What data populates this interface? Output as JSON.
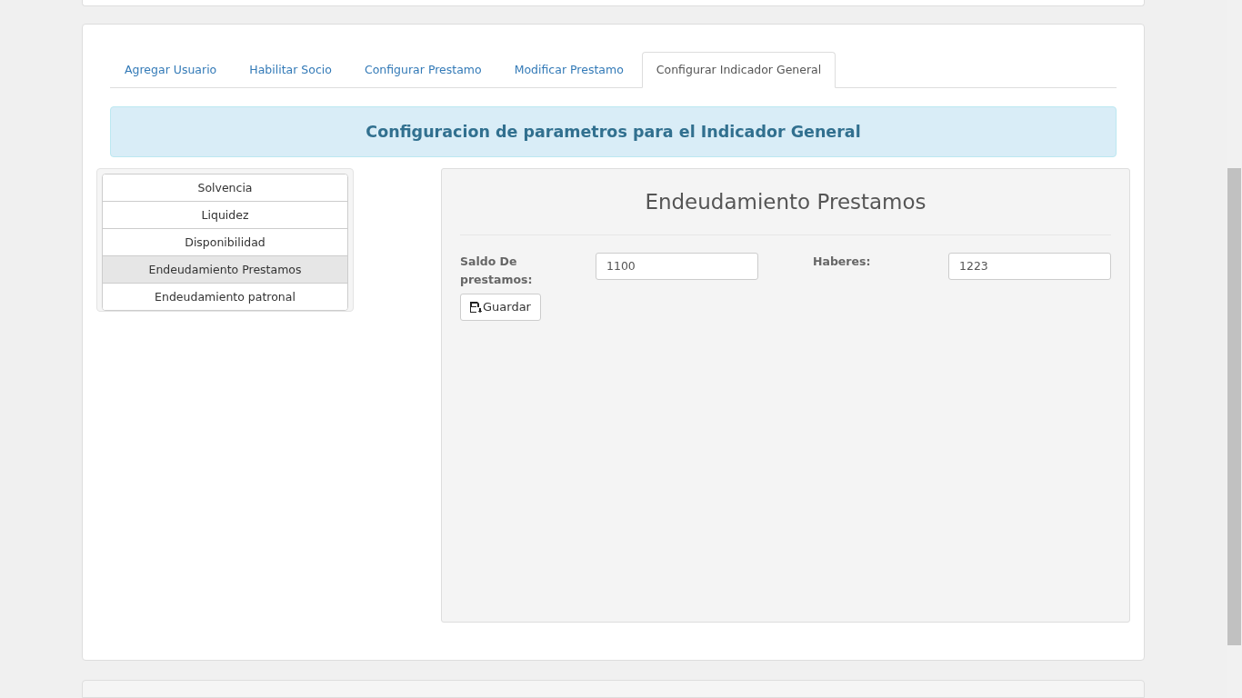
{
  "tabs": [
    {
      "label": "Agregar Usuario",
      "selected": false
    },
    {
      "label": "Habilitar Socio",
      "selected": false
    },
    {
      "label": "Configurar Prestamo",
      "selected": false
    },
    {
      "label": "Modificar Prestamo",
      "selected": false
    },
    {
      "label": "Configurar Indicador General",
      "selected": true
    }
  ],
  "banner": "Configuracion de parametros para el Indicador General",
  "indicators": [
    {
      "label": "Solvencia",
      "selected": false
    },
    {
      "label": "Liquidez",
      "selected": false
    },
    {
      "label": "Disponibilidad",
      "selected": false
    },
    {
      "label": "Endeudamiento Prestamos",
      "selected": true
    },
    {
      "label": "Endeudamiento patronal",
      "selected": false
    }
  ],
  "panel": {
    "title": "Endeudamiento Prestamos",
    "fields": [
      {
        "label": "Saldo De prestamos:",
        "value": "1100"
      },
      {
        "label": "Haberes:",
        "value": "1223"
      }
    ],
    "save_button": "Guardar"
  }
}
